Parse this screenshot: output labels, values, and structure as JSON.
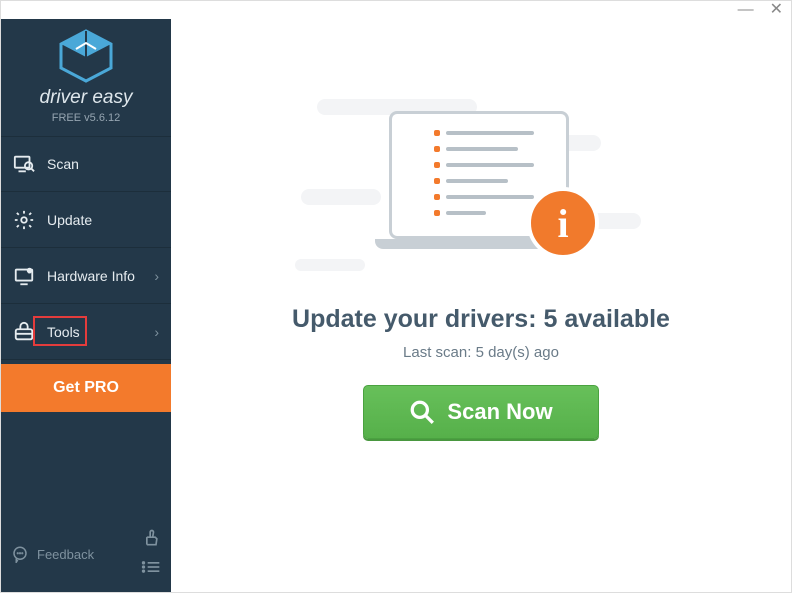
{
  "brand": "driver easy",
  "version": "FREE v5.6.12",
  "sidebar": {
    "items": [
      {
        "label": "Scan",
        "chevron": ""
      },
      {
        "label": "Update",
        "chevron": ""
      },
      {
        "label": "Hardware Info",
        "chevron": "›"
      },
      {
        "label": "Tools",
        "chevron": "›"
      }
    ],
    "getpro_label": "Get PRO",
    "feedback_label": "Feedback"
  },
  "main": {
    "headline": "Update your drivers: 5 available",
    "subline": "Last scan: 5 day(s) ago",
    "scan_label": "Scan Now",
    "info_glyph": "i"
  },
  "window": {
    "minimize": "—",
    "close": "✕"
  },
  "colors": {
    "sidebar": "#233849",
    "accent": "#f37a2c",
    "primary_btn": "#5fbb53"
  }
}
